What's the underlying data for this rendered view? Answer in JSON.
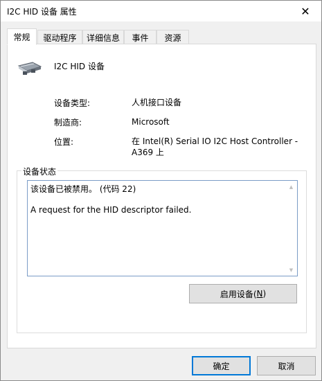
{
  "window": {
    "title": "I2C HID 设备 属性",
    "close_glyph": "✕"
  },
  "tabs": [
    {
      "label": "常规",
      "active": true
    },
    {
      "label": "驱动程序",
      "active": false
    },
    {
      "label": "详细信息",
      "active": false
    },
    {
      "label": "事件",
      "active": false
    },
    {
      "label": "资源",
      "active": false
    }
  ],
  "device": {
    "name": "I2C HID 设备",
    "icon": "hid-device-icon"
  },
  "properties": {
    "type_label": "设备类型:",
    "type_value": "人机接口设备",
    "manufacturer_label": "制造商:",
    "manufacturer_value": "Microsoft",
    "location_label": "位置:",
    "location_value": "在 Intel(R) Serial IO I2C Host Controller - A369 上"
  },
  "status": {
    "group_title": "设备状态",
    "line1": "该设备已被禁用。 (代码 22)",
    "line2": "A request for the HID descriptor failed."
  },
  "buttons": {
    "enable_prefix": "启用设备(",
    "enable_mnemonic": "N",
    "enable_suffix": ")",
    "ok": "确定",
    "cancel": "取消"
  },
  "colors": {
    "accent": "#0078d7",
    "status_border": "#7a9cc6"
  }
}
